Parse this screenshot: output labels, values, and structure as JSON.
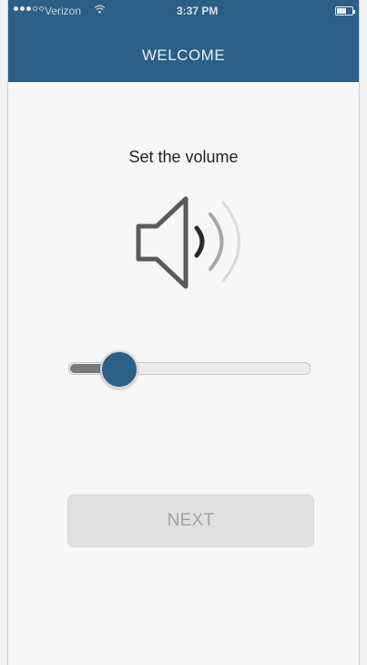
{
  "status_bar": {
    "carrier": "Verizon",
    "wifi_icon": "wifi-icon",
    "time": "3:37 PM",
    "battery_level": 0.6
  },
  "header": {
    "title": "WELCOME",
    "color": "#2c5f85"
  },
  "main": {
    "prompt": "Set the volume",
    "volume_icon": "speaker-volume-icon",
    "slider": {
      "value": 0.18
    },
    "next_button": {
      "label": "NEXT",
      "enabled": false
    }
  },
  "colors": {
    "accent": "#2c5f85",
    "button_disabled": "#e1e1e1",
    "button_text_disabled": "#a2a2a2"
  }
}
